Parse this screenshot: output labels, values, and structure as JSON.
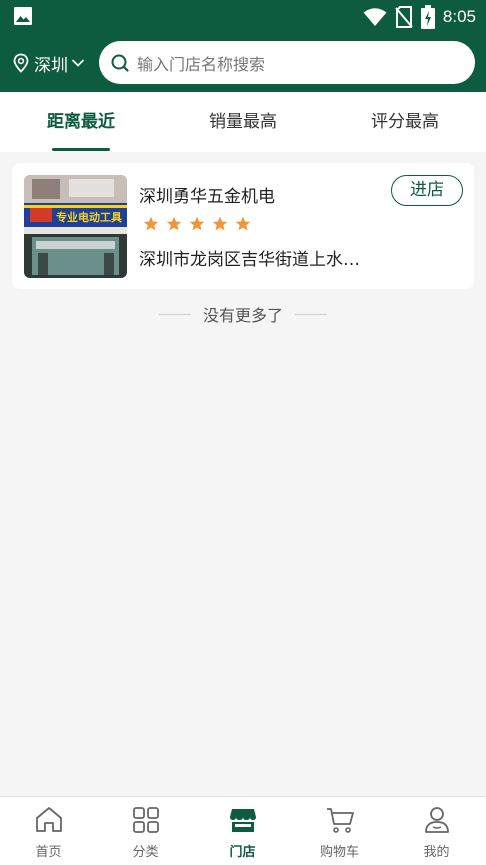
{
  "status_bar": {
    "time": "8:05"
  },
  "header": {
    "city": "深圳",
    "search_placeholder": "输入门店名称搜索"
  },
  "tabs": [
    {
      "label": "距离最近",
      "active": true
    },
    {
      "label": "销量最高",
      "active": false
    },
    {
      "label": "评分最高",
      "active": false
    }
  ],
  "store": {
    "name": "深圳勇华五金机电",
    "rating": 5,
    "address": "深圳市龙岗区吉华街道上水…",
    "enter_label": "进店",
    "sign_text": "专业电动工具"
  },
  "footer_text": "没有更多了",
  "bottom_nav": [
    {
      "label": "首页",
      "icon": "home-icon"
    },
    {
      "label": "分类",
      "icon": "grid-icon"
    },
    {
      "label": "门店",
      "icon": "store-icon",
      "active": true
    },
    {
      "label": "购物车",
      "icon": "cart-icon"
    },
    {
      "label": "我的",
      "icon": "user-icon"
    }
  ],
  "colors": {
    "brand": "#0d5c3f",
    "star": "#f0963a"
  }
}
